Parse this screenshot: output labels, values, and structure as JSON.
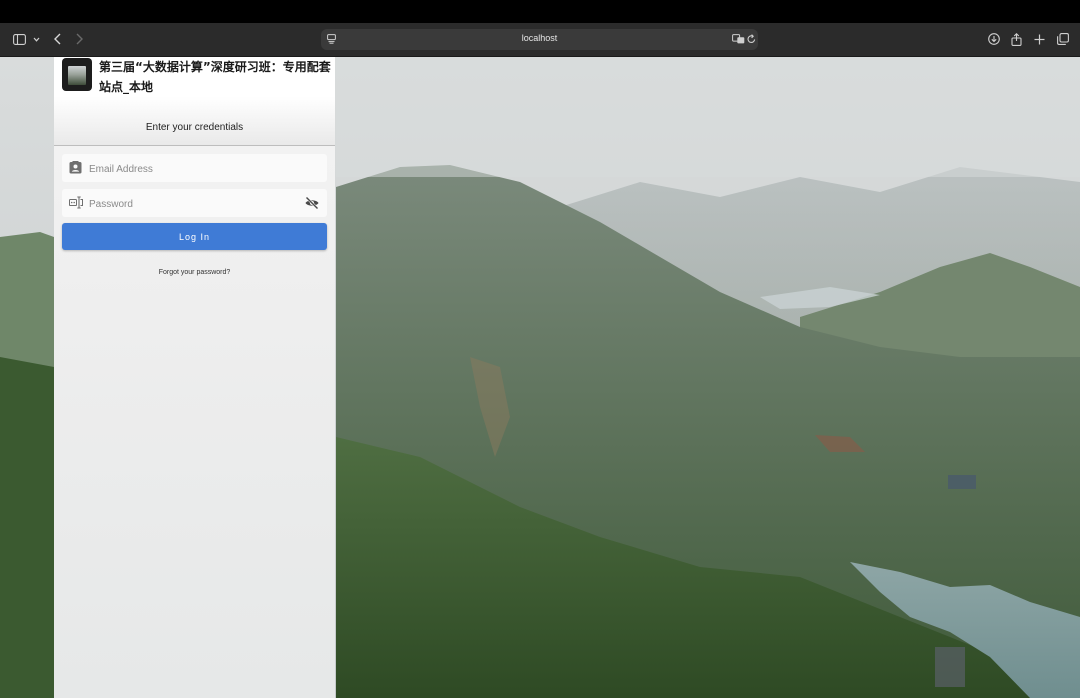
{
  "browser": {
    "url": "localhost"
  },
  "login": {
    "site_title": "第三届“大数据计算”深度研习班：专用配套站点_本地",
    "credentials_label": "Enter your credentials",
    "email_placeholder": "Email Address",
    "password_placeholder": "Password",
    "login_button": "Log In",
    "forgot_link": "Forgot your password?"
  },
  "colors": {
    "accent": "#3f7bd6",
    "toolbar": "#2b2b2b"
  },
  "icons": [
    "sidebar-toggle-icon",
    "chevron-down-icon",
    "back-icon",
    "forward-icon",
    "page-settings-icon",
    "translate-icon",
    "reload-icon",
    "download-icon",
    "share-icon",
    "new-tab-icon",
    "tab-overview-icon",
    "contact-card-icon",
    "password-field-icon",
    "visibility-off-icon"
  ]
}
